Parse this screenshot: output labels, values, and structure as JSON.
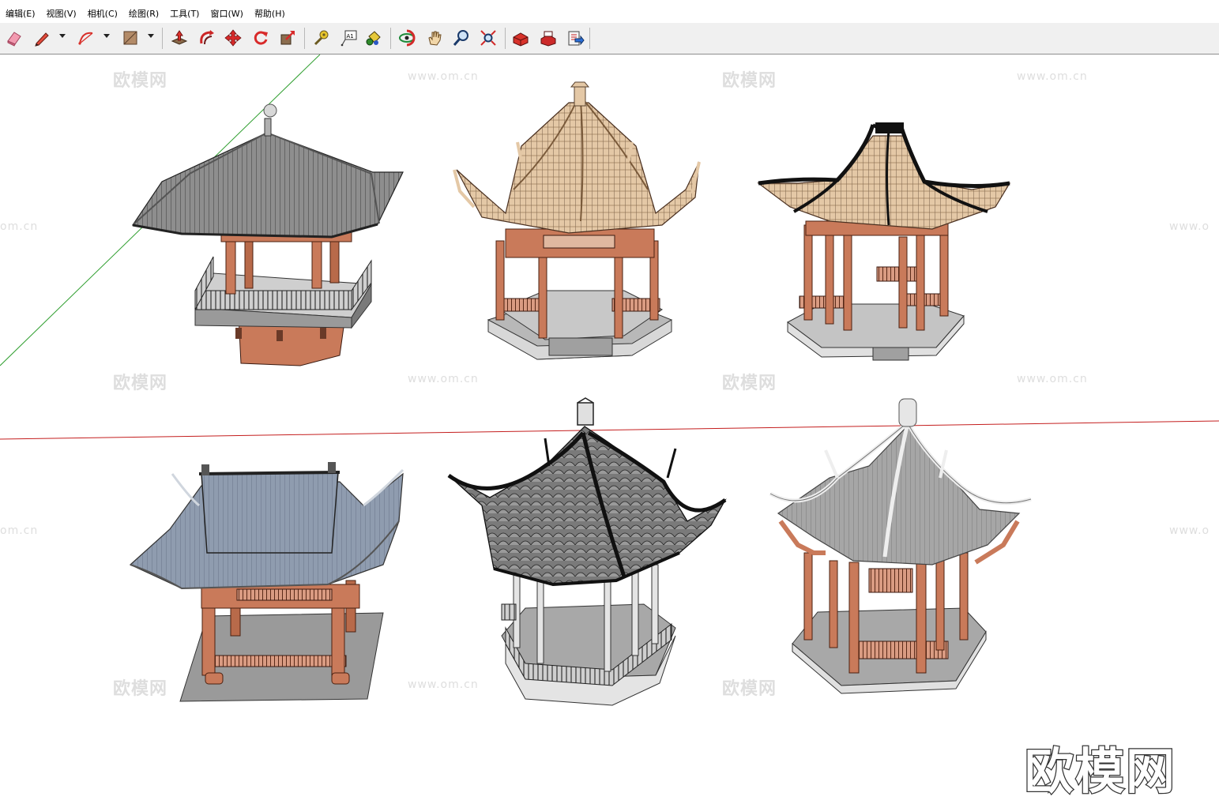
{
  "menu": [
    "编辑(E)",
    "视图(V)",
    "相机(C)",
    "绘图(R)",
    "工具(T)",
    "窗口(W)",
    "帮助(H)"
  ],
  "toolbar": {
    "tools": [
      {
        "name": "eraser-icon"
      },
      {
        "name": "pencil-icon"
      },
      {
        "name": "arc-icon"
      },
      {
        "name": "shape-icon"
      },
      {
        "name": "push-pull-icon"
      },
      {
        "name": "follow-me-icon"
      },
      {
        "name": "move-icon"
      },
      {
        "name": "rotate-icon"
      },
      {
        "name": "scale-icon"
      },
      {
        "name": "tape-measure-icon"
      },
      {
        "name": "text-icon"
      },
      {
        "name": "paint-bucket-icon"
      },
      {
        "name": "orbit-icon"
      },
      {
        "name": "pan-icon"
      },
      {
        "name": "zoom-icon"
      },
      {
        "name": "zoom-extents-icon"
      },
      {
        "name": "warehouse-icon"
      },
      {
        "name": "extension-icon"
      },
      {
        "name": "share-model-icon"
      }
    ],
    "text_tool_glyph": "A1"
  },
  "watermarks": {
    "brand_cn": "欧模网",
    "url": "www.om.cn",
    "url_cut": "om.cn",
    "url_partial": "www.o"
  },
  "logo": "欧模网",
  "colors": {
    "axis_green": "#2e9e2e",
    "axis_red": "#c41e1e",
    "wood": "#c77a5c",
    "roof_grey": "#8a8a8a",
    "roof_blue": "#8c9aae",
    "roof_tan": "#e0c3a0",
    "ground": "#9a9a9a"
  },
  "model": {
    "items": [
      {
        "name": "pavilion-square-grey-roof"
      },
      {
        "name": "pavilion-hexagon-tan-roof"
      },
      {
        "name": "pavilion-hexagon-black-ridge"
      },
      {
        "name": "pavilion-gable-blue-roof"
      },
      {
        "name": "pavilion-hexagon-dark-tile"
      },
      {
        "name": "pavilion-hexagon-white-ridge"
      }
    ]
  }
}
